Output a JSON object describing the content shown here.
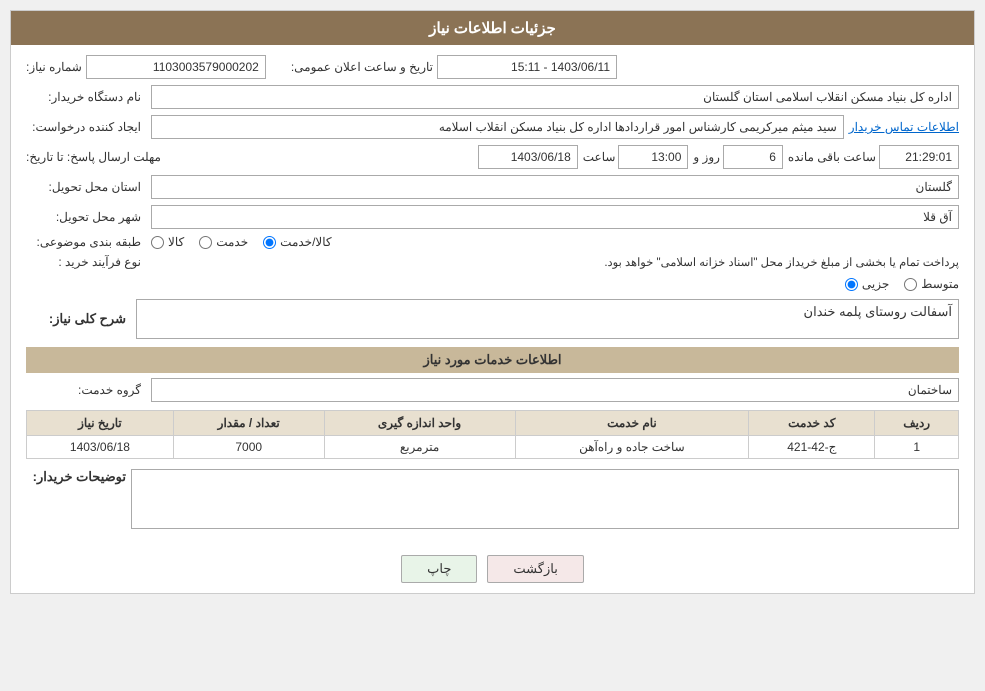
{
  "header": {
    "title": "جزئیات اطلاعات نیاز"
  },
  "fields": {
    "need_number_label": "شماره نیاز:",
    "need_number_value": "1103003579000202",
    "announce_date_label": "تاریخ و ساعت اعلان عمومی:",
    "announce_date_value": "1403/06/11 - 15:11",
    "buyer_name_label": "نام دستگاه خریدار:",
    "buyer_name_value": "اداره کل بنیاد مسکن انقلاب اسلامی استان گلستان",
    "creator_label": "ایجاد کننده درخواست:",
    "creator_value": "سید میثم میرکریمی کارشناس امور قراردادها اداره کل بنیاد مسکن انقلاب اسلامه",
    "contact_info_link": "اطلاعات تماس خریدار",
    "deadline_label": "مهلت ارسال پاسخ: تا تاریخ:",
    "deadline_date": "1403/06/18",
    "deadline_time_label": "ساعت",
    "deadline_time": "13:00",
    "deadline_days_label": "روز و",
    "deadline_days": "6",
    "deadline_remaining_label": "ساعت باقی مانده",
    "deadline_remaining": "21:29:01",
    "province_label": "استان محل تحویل:",
    "province_value": "گلستان",
    "city_label": "شهر محل تحویل:",
    "city_value": "آق قلا",
    "category_label": "طبقه بندی موضوعی:",
    "category_kala": "کالا",
    "category_khedmat": "خدمت",
    "category_kala_khedmat": "کالا/خدمت",
    "category_selected": "kala_khedmat",
    "purchase_type_label": "نوع فرآیند خرید :",
    "purchase_jozee": "جزیی",
    "purchase_motawaset": "متوسط",
    "purchase_note": "پرداخت تمام یا بخشی از مبلغ خریداز محل \"اسناد خزانه اسلامی\" خواهد بود.",
    "need_desc_label": "شرح کلی نیاز:",
    "need_desc_value": "آسفالت روستای پلمه خندان",
    "services_section_label": "اطلاعات خدمات مورد نیاز",
    "service_group_label": "گروه خدمت:",
    "service_group_value": "ساختمان",
    "table_headers": {
      "row_num": "ردیف",
      "service_code": "کد خدمت",
      "service_name": "نام خدمت",
      "unit": "واحد اندازه گیری",
      "quantity": "تعداد / مقدار",
      "need_date": "تاریخ نیاز"
    },
    "table_rows": [
      {
        "row_num": "1",
        "service_code": "ج-42-421",
        "service_name": "ساخت جاده و راه‌آهن",
        "unit": "مترمربع",
        "quantity": "7000",
        "need_date": "1403/06/18"
      }
    ],
    "buyer_desc_label": "توضیحات خریدار:",
    "buyer_desc_value": "",
    "btn_print": "چاپ",
    "btn_back": "بازگشت"
  }
}
